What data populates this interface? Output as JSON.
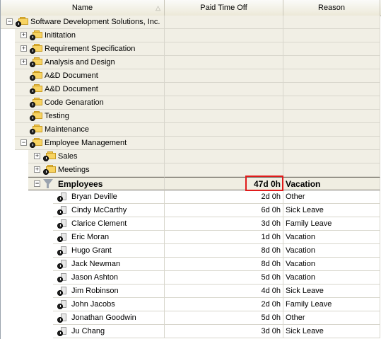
{
  "columns": {
    "name": "Name",
    "pto": "Paid Time Off",
    "reason": "Reason"
  },
  "rows": [
    {
      "type": "group",
      "level": 0,
      "label": "Software Development Solutions, Inc.",
      "expander": "−",
      "pto": "",
      "reason": ""
    },
    {
      "type": "group",
      "level": 1,
      "label": "Inititation",
      "expander": "+",
      "pto": "",
      "reason": ""
    },
    {
      "type": "group",
      "level": 1,
      "label": "Requirement Specification",
      "expander": "+",
      "pto": "",
      "reason": ""
    },
    {
      "type": "group",
      "level": 1,
      "label": "Analysis and Design",
      "expander": "+",
      "pto": "",
      "reason": ""
    },
    {
      "type": "group",
      "level": 1,
      "label": "A&D Document",
      "expander": "",
      "pto": "",
      "reason": ""
    },
    {
      "type": "group",
      "level": 1,
      "label": "A&D Document",
      "expander": "",
      "pto": "",
      "reason": ""
    },
    {
      "type": "group",
      "level": 1,
      "label": "Code Genaration",
      "expander": "",
      "pto": "",
      "reason": ""
    },
    {
      "type": "group",
      "level": 1,
      "label": "Testing",
      "expander": "",
      "pto": "",
      "reason": ""
    },
    {
      "type": "group",
      "level": 1,
      "label": "Maintenance",
      "expander": "",
      "pto": "",
      "reason": ""
    },
    {
      "type": "group",
      "level": 1,
      "label": "Employee Management",
      "expander": "−",
      "pto": "",
      "reason": ""
    },
    {
      "type": "group",
      "level": 2,
      "label": "Sales",
      "expander": "+",
      "pto": "",
      "reason": ""
    },
    {
      "type": "group",
      "level": 2,
      "label": "Meetings",
      "expander": "+",
      "pto": "",
      "reason": ""
    },
    {
      "type": "emp",
      "level": 2,
      "label": "Employees",
      "expander": "−",
      "pto": "47d 0h",
      "reason": "Vacation"
    },
    {
      "type": "detail",
      "label": "Bryan Deville",
      "pto": "2d 0h",
      "reason": "Other"
    },
    {
      "type": "detail",
      "label": "Cindy McCarthy",
      "pto": "6d 0h",
      "reason": "Sick Leave"
    },
    {
      "type": "detail",
      "label": "Clarice Clement",
      "pto": "3d 0h",
      "reason": "Family Leave"
    },
    {
      "type": "detail",
      "label": "Eric Moran",
      "pto": "1d 0h",
      "reason": "Vacation"
    },
    {
      "type": "detail",
      "label": "Hugo Grant",
      "pto": "8d 0h",
      "reason": "Vacation"
    },
    {
      "type": "detail",
      "label": "Jack Newman",
      "pto": "8d 0h",
      "reason": "Vacation"
    },
    {
      "type": "detail",
      "label": "Jason Ashton",
      "pto": "5d 0h",
      "reason": "Vacation"
    },
    {
      "type": "detail",
      "label": "Jim Robinson",
      "pto": "4d 0h",
      "reason": "Sick Leave"
    },
    {
      "type": "detail",
      "label": "John Jacobs",
      "pto": "2d 0h",
      "reason": "Family Leave"
    },
    {
      "type": "detail",
      "label": "Jonathan Goodwin",
      "pto": "5d 0h",
      "reason": "Other"
    },
    {
      "type": "detail",
      "label": "Ju Chang",
      "pto": "3d 0h",
      "reason": "Sick Leave"
    }
  ],
  "icons": {
    "folder": "folder-icon",
    "clock": "clock-icon",
    "filter": "filter-icon",
    "page": "page-icon",
    "sort": "sort-ascending-icon"
  },
  "colors": {
    "highlight": "#e01b1b",
    "group_bg": "#f1efe5"
  }
}
